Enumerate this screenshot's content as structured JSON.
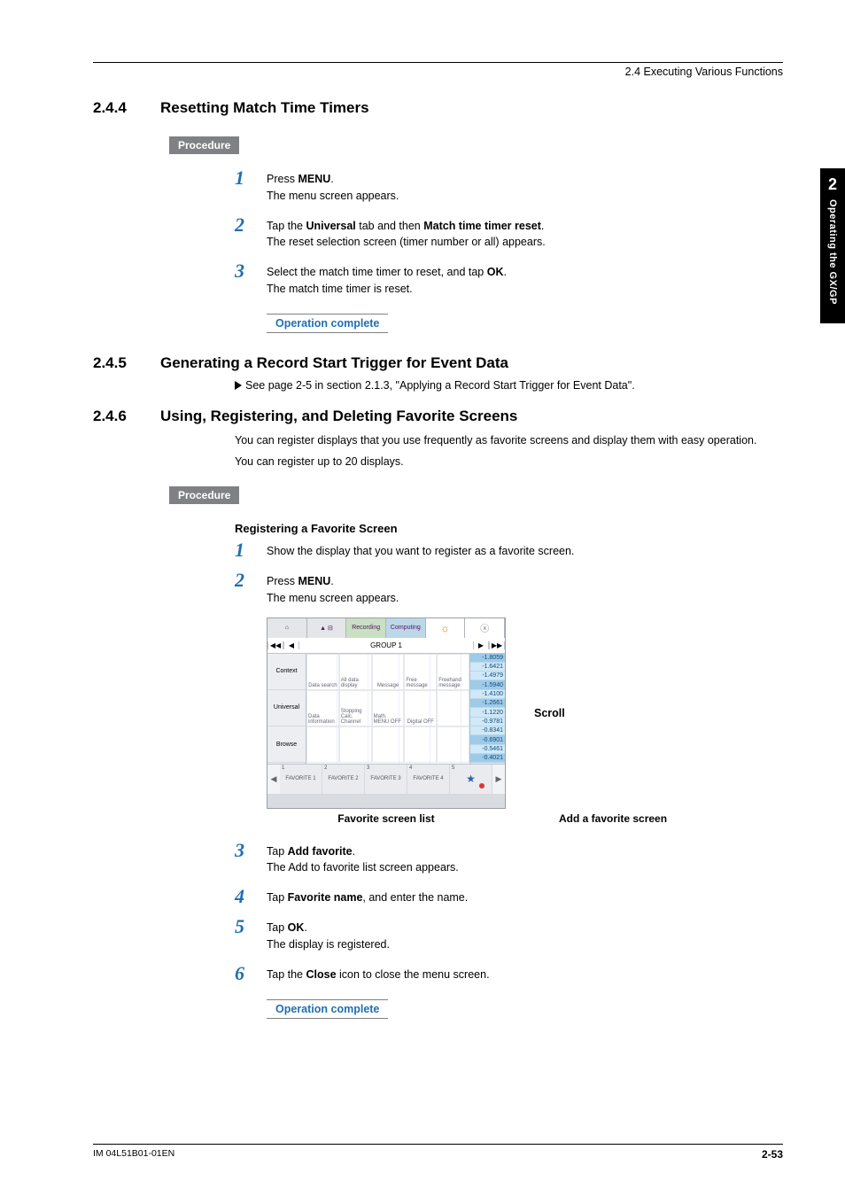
{
  "breadcrumb": "2.4  Executing Various Functions",
  "side_tab": {
    "num": "2",
    "label": "Operating the GX/GP"
  },
  "s244": {
    "num": "2.4.4",
    "title": "Resetting Match Time Timers",
    "procedure_label": "Procedure",
    "steps": [
      {
        "n": "1",
        "line1a": "Press ",
        "bold1": "MENU",
        "line1b": ".",
        "line2": "The menu screen appears."
      },
      {
        "n": "2",
        "line1a": "Tap the ",
        "bold1": "Universal",
        "mid": " tab and then ",
        "bold2": "Match time timer reset",
        "line1b": ".",
        "line2": "The reset selection screen (timer number or all) appears."
      },
      {
        "n": "3",
        "line1a": "Select the match time timer to reset, and tap ",
        "bold1": "OK",
        "line1b": ".",
        "line2": "The match time timer is reset."
      }
    ],
    "op_complete": "Operation complete"
  },
  "s245": {
    "num": "2.4.5",
    "title": "Generating a Record Start Trigger for Event Data",
    "xref": "See page 2-5 in section 2.1.3, \"Applying a Record Start Trigger for Event Data\"."
  },
  "s246": {
    "num": "2.4.6",
    "title": "Using, Registering, and Deleting Favorite Screens",
    "intro1": "You can register displays that you use frequently as favorite screens and display them with easy operation.",
    "intro2": "You can register up to 20 displays.",
    "procedure_label": "Procedure",
    "subhead": "Registering a Favorite Screen",
    "steps_a": [
      {
        "n": "1",
        "line1": "Show the display that you want to register as a favorite screen."
      },
      {
        "n": "2",
        "line1a": "Press ",
        "bold1": "MENU",
        "line1b": ".",
        "line2": "The menu screen appears."
      }
    ],
    "fig": {
      "topbar": {
        "home": "⌂",
        "alarm": "▲ ⊟",
        "rec": "Recording",
        "comp": "Computing",
        "bright": "☼",
        "close": "ⓧ"
      },
      "group_prev2": "◀◀",
      "group_prev": "◀",
      "group": "GROUP 1",
      "group_next": "▶",
      "group_next2": "▶▶",
      "side": [
        "Context",
        "Universal",
        "Browse"
      ],
      "grid_labels": [
        "Data search",
        "All data display",
        "Message",
        "Free message",
        "Freehand message",
        "Data information",
        "Stopping Calc. Channel",
        "Math. MENU OFF",
        "Digital OFF",
        ""
      ],
      "right_vals": [
        "-1.8059",
        "-1.6421",
        "-1.4979",
        "-1.5940",
        "-1.4100",
        "-1.2661",
        "-1.1220",
        "-0.9781",
        "-0.8341",
        "-0.6901",
        "-0.5461",
        "-0.4021"
      ],
      "fav_slots": [
        "FAVORITE 1",
        "FAVORITE 2",
        "FAVORITE 3",
        "FAVORITE 4"
      ],
      "fav_nums": [
        "1",
        "2",
        "3",
        "4",
        "5"
      ],
      "fav_add": "Add favorite",
      "scroll_label": "Scroll",
      "caption_list": "Favorite screen list",
      "caption_add": "Add a favorite screen"
    },
    "steps_b": [
      {
        "n": "3",
        "line1a": "Tap ",
        "bold1": "Add favorite",
        "line1b": ".",
        "line2": "The Add to favorite list screen appears."
      },
      {
        "n": "4",
        "line1a": "Tap ",
        "bold1": "Favorite name",
        "line1b": ", and enter the name."
      },
      {
        "n": "5",
        "line1a": "Tap ",
        "bold1": "OK",
        "line1b": ".",
        "line2": "The display is registered."
      },
      {
        "n": "6",
        "line1a": "Tap the ",
        "bold1": "Close",
        "line1b": " icon to close the menu screen."
      }
    ],
    "op_complete": "Operation complete"
  },
  "footer": {
    "doc": "IM 04L51B01-01EN",
    "page": "2-53"
  }
}
